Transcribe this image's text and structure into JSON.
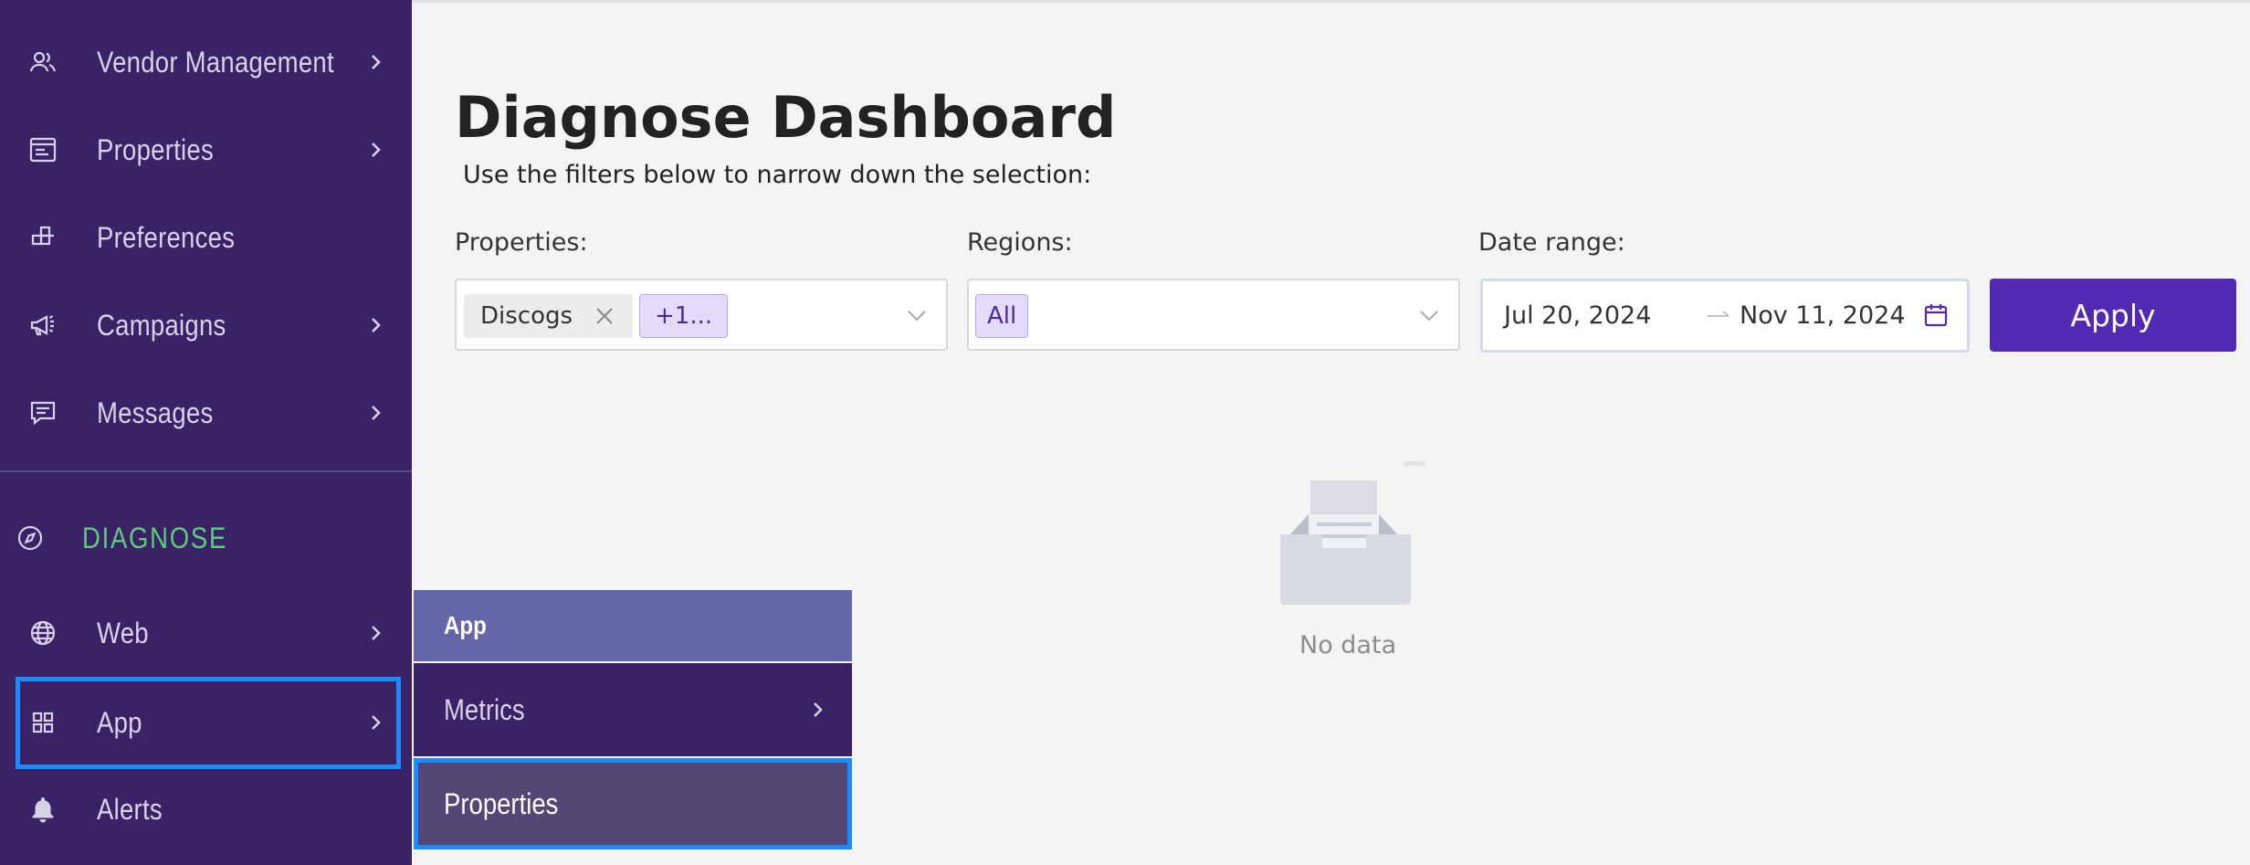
{
  "sidebar": {
    "items": [
      {
        "label": "Vendor Management",
        "icon": "users-icon",
        "has_submenu": true
      },
      {
        "label": "Properties",
        "icon": "properties-icon",
        "has_submenu": true
      },
      {
        "label": "Preferences",
        "icon": "preferences-icon",
        "has_submenu": false
      },
      {
        "label": "Campaigns",
        "icon": "megaphone-icon",
        "has_submenu": true
      },
      {
        "label": "Messages",
        "icon": "message-icon",
        "has_submenu": true
      }
    ],
    "section": {
      "label": "DIAGNOSE",
      "icon": "compass-icon"
    },
    "section_items": [
      {
        "label": "Web",
        "icon": "globe-icon",
        "has_submenu": true
      },
      {
        "label": "App",
        "icon": "grid-icon",
        "has_submenu": true,
        "selected": true
      },
      {
        "label": "Alerts",
        "icon": "bell-icon",
        "has_submenu": false
      }
    ]
  },
  "flyout": {
    "header": "App",
    "items": [
      {
        "label": "Metrics",
        "has_submenu": true
      },
      {
        "label": "Properties",
        "has_submenu": false,
        "selected": true
      }
    ]
  },
  "main": {
    "title": "Diagnose Dashboard",
    "subtitle": "Use the filters below to narrow down the selection:",
    "filters": {
      "properties": {
        "label": "Properties:",
        "tags": [
          "Discogs"
        ],
        "more": "+1..."
      },
      "regions": {
        "label": "Regions:",
        "tags": [
          "All"
        ]
      },
      "date_range": {
        "label": "Date range:",
        "start": "Jul 20, 2024",
        "end": "Nov 11, 2024"
      }
    },
    "apply_label": "Apply",
    "empty_text": "No data"
  },
  "colors": {
    "sidebar_bg": "#3a2266",
    "accent": "#5229b3",
    "section_green": "#5fca7e",
    "selection_outline": "#1a8cff",
    "flyout_header": "#6466a8"
  }
}
